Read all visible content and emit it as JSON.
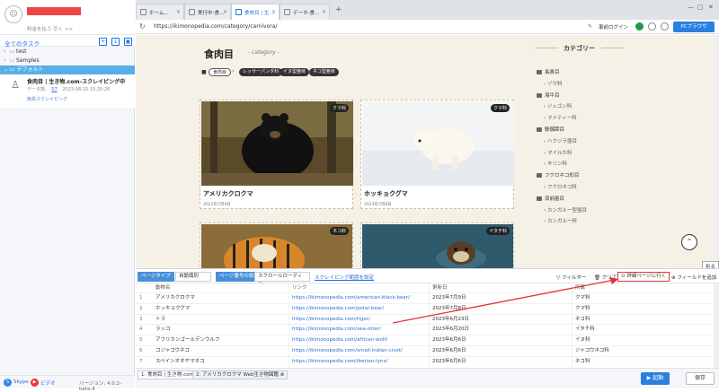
{
  "account": {
    "plan_text": "料金を払う 引く >>"
  },
  "tasks": {
    "title": "全てのタスク",
    "tree": [
      {
        "label": "test"
      },
      {
        "label": "Samples"
      }
    ],
    "group": "デフォルト",
    "task": {
      "title": "食肉目 | 生き物.com-スクレイピング中",
      "meta_label": "データ数:",
      "meta_count": "57",
      "meta_time": "2023-08-15 15:20:26",
      "sub": "簡易スクレイピング"
    }
  },
  "footer": {
    "skype": "Skype",
    "video": "ビデオ",
    "version": "バージョン: 4.0.2-beta.4"
  },
  "browser": {
    "tabs": [
      {
        "label": "ホーム..."
      },
      {
        "label": "実行中-食..."
      },
      {
        "label": "食肉目 | 生..."
      },
      {
        "label": "データ-食..."
      }
    ],
    "url": "https://ikimonopedia.com/category/carnivora/",
    "login": "事前ログイン",
    "mode": "PCブラウザ"
  },
  "webpage": {
    "title": "食肉目",
    "subtitle": "- category -",
    "breadcrumbs": [
      "食肉目",
      "レッサーパンダ科",
      "イヌ型亜目",
      "ネコ型亜目"
    ],
    "cards": [
      {
        "title": "アメリカクロクマ",
        "tag": "クマ科",
        "date": "2023年7月9日"
      },
      {
        "title": "ホッキョクグマ",
        "tag": "クマ科",
        "date": "2023年7月8日"
      },
      {
        "tag": "ネコ科"
      },
      {
        "tag": "イタチ科"
      }
    ],
    "sidebar_title": "カテゴリー",
    "categories": [
      {
        "label": "長鼻目",
        "sub": false
      },
      {
        "label": "ゾウ科",
        "sub": true
      },
      {
        "label": "海牛目",
        "sub": false
      },
      {
        "label": "ジュゴン科",
        "sub": true
      },
      {
        "label": "マナティー科",
        "sub": true
      },
      {
        "label": "鯨偶蹄目",
        "sub": false
      },
      {
        "label": "ハクジラ亜目",
        "sub": true
      },
      {
        "label": "マイルカ科",
        "sub": true
      },
      {
        "label": "キリン科",
        "sub": true
      },
      {
        "label": "フクロネコ形目",
        "sub": false
      },
      {
        "label": "フクロネコ科",
        "sub": true
      },
      {
        "label": "双前歯目",
        "sub": false
      },
      {
        "label": "カンガルー型亜目",
        "sub": true
      },
      {
        "label": "カンガルー科",
        "sub": true
      }
    ],
    "fold": "折る"
  },
  "toolbar": {
    "page_type_label": "ページタイプ",
    "page_type_value": "自動識別",
    "page_turn_label": "ページ番号の設定",
    "page_turn_value": "スクロールローディン",
    "scroll_link": "スクレイピング範囲を設定",
    "filter": "フィルター",
    "clear": "クリア",
    "detail": "詳細ページに行く",
    "add_field": "フィールドを追加"
  },
  "table": {
    "headers": [
      "動物名",
      "リンク",
      "更新日",
      "所属"
    ],
    "rows": [
      {
        "n": "1",
        "name": "アメリカクロクマ",
        "link": "https://ikimonopedia.com/american-black-bear/",
        "date": "2023年7月9日",
        "group": "クマ科"
      },
      {
        "n": "2",
        "name": "ホッキョクグマ",
        "link": "https://ikimonopedia.com/polar-bear/",
        "date": "2023年7月8日",
        "group": "クマ科"
      },
      {
        "n": "3",
        "name": "トラ",
        "link": "https://ikimonopedia.com/tiger/",
        "date": "2023年6月23日",
        "group": "ネコ科"
      },
      {
        "n": "4",
        "name": "ラッコ",
        "link": "https://ikimonopedia.com/sea-otter/",
        "date": "2023年6月20日",
        "group": "イタチ科"
      },
      {
        "n": "5",
        "name": "アフリカンゴールデンウルフ",
        "link": "https://ikimonopedia.com/african-wolf/",
        "date": "2023年6月6日",
        "group": "イヌ科"
      },
      {
        "n": "6",
        "name": "コジャコウネコ",
        "link": "https://ikimonopedia.com/small-indian-civet/",
        "date": "2023年6月6日",
        "group": "ジャコウネコ科"
      },
      {
        "n": "7",
        "name": "スペインオオヤマネコ",
        "link": "https://ikimonopedia.com/iberian-lynx/",
        "date": "2023年6月6日",
        "group": "ネコ科"
      }
    ]
  },
  "bottom_tabs": [
    "1. 食肉目 | 生き物.com",
    "2. アメリカクロクマ Web生き物図鑑"
  ],
  "actions": {
    "start": "起動",
    "save": "保存"
  },
  "colors": {
    "accent": "#2b7fe0",
    "highlight": "#e33333",
    "group_bg": "#5aaee6"
  }
}
